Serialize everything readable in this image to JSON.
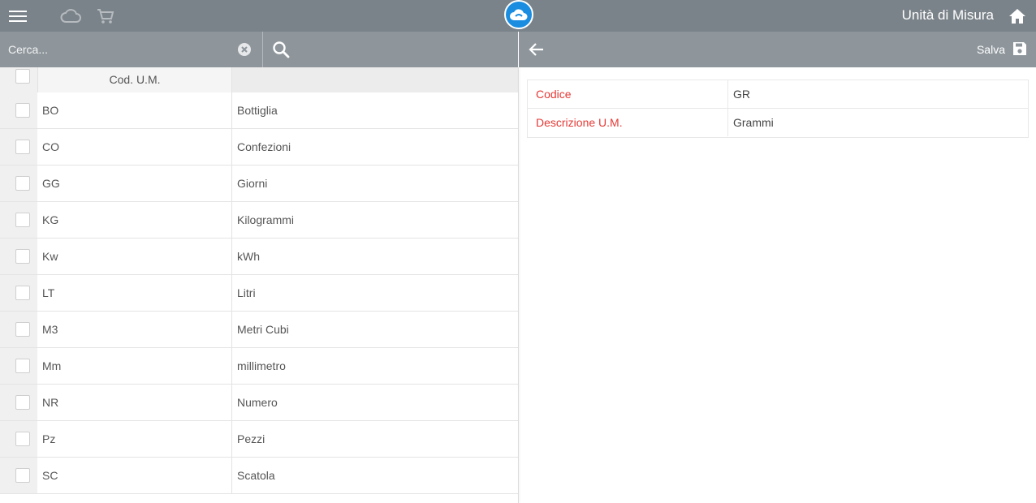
{
  "header": {
    "title": "Unità di Misura",
    "icons": [
      "menu-icon",
      "cloud-icon",
      "cart-icon",
      "app-logo",
      "home-icon"
    ]
  },
  "search": {
    "placeholder": "Cerca...",
    "value": ""
  },
  "detail_toolbar": {
    "save_label": "Salva"
  },
  "table": {
    "columns": [
      "Cod. U.M.",
      ""
    ],
    "rows": [
      {
        "code": "BO",
        "description": "Bottiglia"
      },
      {
        "code": "CO",
        "description": "Confezioni"
      },
      {
        "code": "GG",
        "description": "Giorni"
      },
      {
        "code": "KG",
        "description": "Kilogrammi"
      },
      {
        "code": "Kw",
        "description": "kWh"
      },
      {
        "code": "LT",
        "description": "Litri"
      },
      {
        "code": "M3",
        "description": "Metri Cubi"
      },
      {
        "code": "Mm",
        "description": "millimetro"
      },
      {
        "code": "NR",
        "description": "Numero"
      },
      {
        "code": "Pz",
        "description": "Pezzi"
      },
      {
        "code": "SC",
        "description": "Scatola"
      }
    ]
  },
  "form": {
    "fields": [
      {
        "label": "Codice",
        "value": "GR"
      },
      {
        "label": "Descrizione U.M.",
        "value": "Grammi"
      }
    ]
  },
  "colors": {
    "topbar": "#7b838a",
    "toolbar": "#8e969c",
    "logo": "#1a8de0",
    "required_label": "#e53935"
  }
}
